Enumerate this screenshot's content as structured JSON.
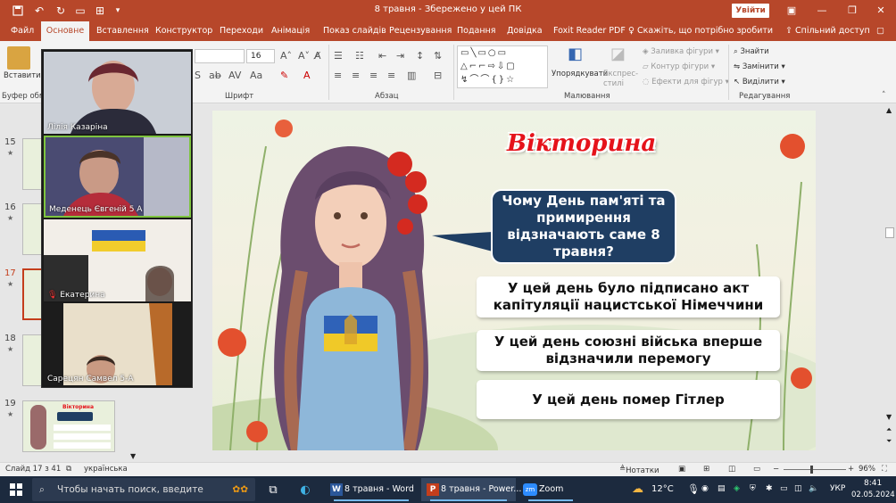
{
  "titlebar": {
    "doc_title": "8 травня  -  Збережено у цей ПК",
    "signin_label": "Увійти"
  },
  "menu": {
    "tabs": [
      "Файл",
      "Основне",
      "Вставлення",
      "Конструктор",
      "Переходи",
      "Анімація",
      "Показ слайдів",
      "Рецензування",
      "Подання",
      "Довідка",
      "Foxit Reader PDF"
    ],
    "tell_me": "Скажіть, що потрібно зробити",
    "share": "Спільний доступ"
  },
  "ribbon": {
    "paste_label": "Вставити",
    "clipboard_label": "Буфер обм",
    "font_group_label": "Шрифт",
    "font_size": "16",
    "paragraph_label": "Абзац",
    "drawing_label": "Малювання",
    "arrange_label": "Упорядкувати",
    "quick_styles_label": "Експрес-стилі",
    "shape_fill": "Заливка фігури",
    "shape_outline": "Контур фігури",
    "shape_effects": "Ефекти для фігур",
    "editing_label": "Редагування",
    "find_label": "Знайти",
    "replace_label": "Замінити",
    "select_label": "Виділити"
  },
  "slides_pane": {
    "slides": [
      {
        "number": "15"
      },
      {
        "number": "16"
      },
      {
        "number": "17"
      },
      {
        "number": "18"
      },
      {
        "number": "19"
      }
    ],
    "active_slide": "17",
    "thumb19_title": "Вікторина"
  },
  "slide": {
    "title": "Вікторина",
    "question": "Чому День пам'яті та примирення відзначають саме 8 травня?",
    "answers": [
      "У цей день було підписано акт капітуляції нацистської Німеччини",
      "У цей день союзні війська вперше відзначили перемогу",
      "У цей день помер Гітлер"
    ]
  },
  "zoom": {
    "participants": [
      {
        "name": "Лілія Казаріна"
      },
      {
        "name": "Меденець Євгеній 5 А"
      },
      {
        "name": "Екатерина"
      },
      {
        "name": "Сарецян Самвел 5-А"
      }
    ]
  },
  "statusbar": {
    "slide_info": "Слайд 17 з 41",
    "language": "українська",
    "notes_label": "Нотатки",
    "zoom_level": "96%"
  },
  "taskbar": {
    "search_placeholder": "Чтобы начать поиск, введите",
    "apps": [
      {
        "label": "8 травня - Word"
      },
      {
        "label": "8 травня - Power..."
      },
      {
        "label": "Zoom"
      }
    ],
    "weather": "12°C",
    "lang": "УКР",
    "time": "8:41",
    "date": "02.05.2024"
  },
  "colors": {
    "accent": "#b7472a",
    "question_bg": "#1f3e63",
    "title_red": "#e5131b"
  }
}
